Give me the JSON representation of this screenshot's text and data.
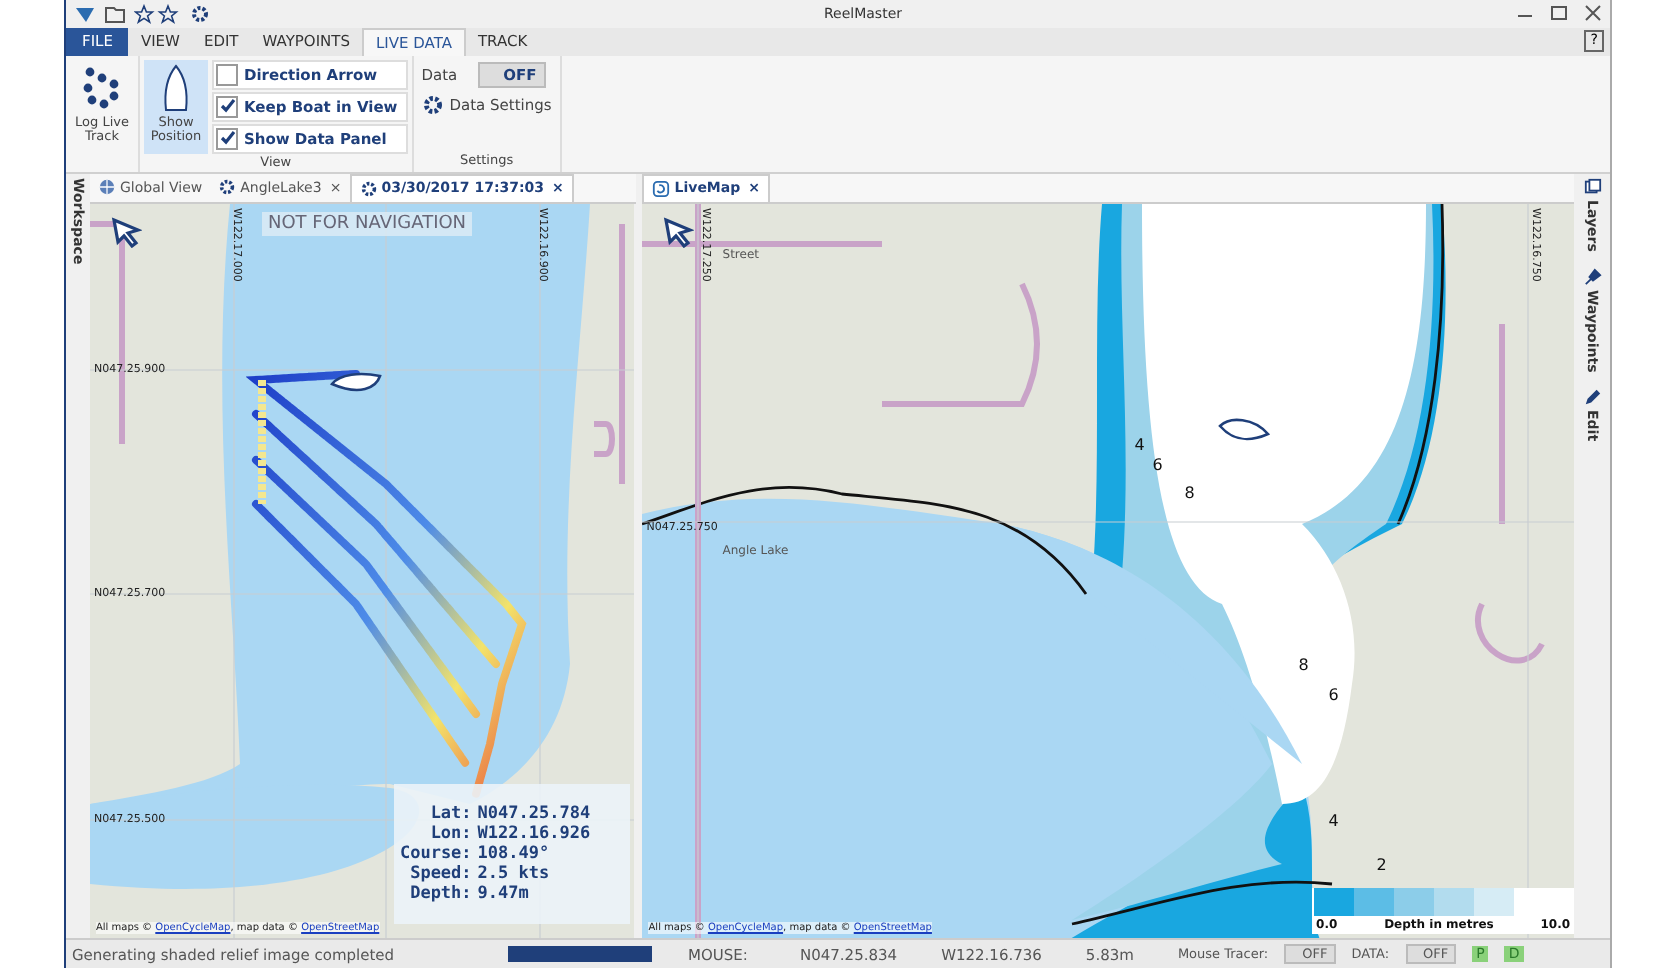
{
  "window": {
    "title": "ReelMaster",
    "help": "?"
  },
  "menu_tabs": [
    {
      "label": "FILE",
      "kind": "file",
      "selected": false
    },
    {
      "label": "VIEW",
      "kind": "tab",
      "selected": false
    },
    {
      "label": "EDIT",
      "kind": "tab",
      "selected": false
    },
    {
      "label": "WAYPOINTS",
      "kind": "tab",
      "selected": false
    },
    {
      "label": "LIVE DATA",
      "kind": "tab",
      "selected": true
    },
    {
      "label": "TRACK",
      "kind": "tab",
      "selected": false
    }
  ],
  "ribbon": {
    "log_button": "Log Live Track",
    "show_position": {
      "label": "Show Position",
      "selected": true
    },
    "checkboxes": [
      {
        "label": "Direction Arrow",
        "checked": false
      },
      {
        "label": "Keep Boat in View",
        "checked": true
      },
      {
        "label": "Show Data Panel",
        "checked": true
      }
    ],
    "view_group": "View",
    "data_label": "Data",
    "data_toggle": {
      "label": "OFF",
      "on": false
    },
    "data_settings": "Data Settings",
    "settings_group": "Settings"
  },
  "left_strip": "Workspace",
  "left_pane": {
    "tabs": [
      {
        "label": "Global View",
        "kind": "globe",
        "selected": false
      },
      {
        "label": "AngleLake3",
        "kind": "gear",
        "close": "×",
        "selected": false
      },
      {
        "label": "03/30/2017 17:37:03",
        "kind": "gear",
        "close": "×",
        "selected": true
      }
    ],
    "banner": "NOT FOR NAVIGATION",
    "labels": [
      {
        "text": "W122.17.000",
        "kind": "lon"
      },
      {
        "text": "W122.16.900",
        "kind": "lon"
      },
      {
        "text": "N047.25.900",
        "kind": "lat"
      },
      {
        "text": "N047.25.700",
        "kind": "lat"
      },
      {
        "text": "N047.25.500",
        "kind": "lat"
      }
    ],
    "data_panel": [
      {
        "name": "Lat:",
        "value": "N047.25.784"
      },
      {
        "name": "Lon:",
        "value": "W122.16.926"
      },
      {
        "name": "Course:",
        "value": "108.49°"
      },
      {
        "name": "Speed:",
        "value": "2.5 kts"
      },
      {
        "name": "Depth:",
        "value": "9.47m"
      }
    ],
    "attribution": {
      "prefix": "All maps ©",
      "link1": "OpenCycleMap",
      "middle": ", map data ©",
      "link2": "OpenStreetMap"
    }
  },
  "right_pane": {
    "tabs": [
      {
        "label": "LiveMap",
        "kind": "live",
        "close": "×",
        "selected": true
      }
    ],
    "labels": [
      {
        "text": "Street",
        "kind": "place"
      },
      {
        "text": "W122.17.250",
        "kind": "lon"
      },
      {
        "text": "W122.16.750",
        "kind": "lon"
      },
      {
        "text": "N047.25.750",
        "kind": "lat"
      },
      {
        "text": "Angle Lake",
        "kind": "place"
      },
      {
        "text": "4",
        "kind": "depth"
      },
      {
        "text": "6",
        "kind": "depth"
      },
      {
        "text": "8",
        "kind": "depth"
      },
      {
        "text": "8",
        "kind": "depth"
      },
      {
        "text": "6",
        "kind": "depth"
      },
      {
        "text": "4",
        "kind": "depth"
      },
      {
        "text": "2",
        "kind": "depth"
      }
    ],
    "legend": {
      "min": "0.0",
      "title": "Depth in metres",
      "max": "10.0"
    },
    "attribution": {
      "prefix": "All maps ©",
      "link1": "OpenCycleMap",
      "middle": ", map data ©",
      "link2": "OpenStreetMap"
    }
  },
  "right_strip": [
    {
      "label": "Layers",
      "kind": "layers"
    },
    {
      "label": "Waypoints",
      "kind": "pin"
    },
    {
      "label": "Edit",
      "kind": "pen"
    }
  ],
  "status_bar": {
    "message": "Generating shaded relief image completed",
    "progress": {
      "level": 1
    },
    "mouse_label": "MOUSE:",
    "lat": "N047.25.834",
    "lon": "W122.16.736",
    "depth": "5.83m",
    "tracer_label": "Mouse Tracer:",
    "tracer": {
      "label": "OFF",
      "on": false
    },
    "data_label": "DATA:",
    "data": {
      "label": "OFF",
      "on": false
    },
    "p": "P",
    "d": "D"
  }
}
